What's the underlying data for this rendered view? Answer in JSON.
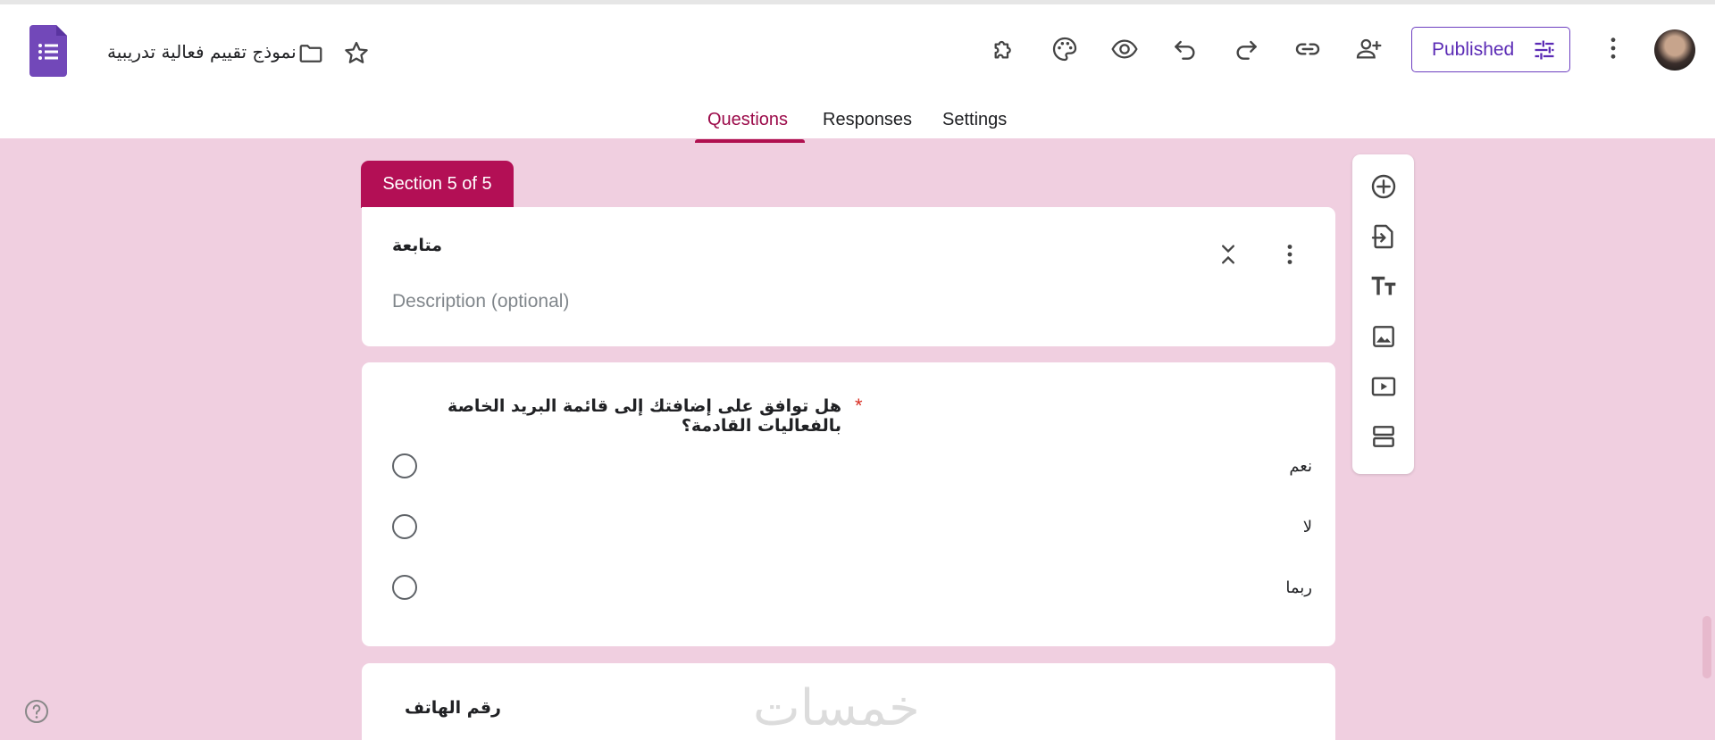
{
  "header": {
    "form_title": "نموذج تقييم فعالية تدريبية",
    "published_label": "Published"
  },
  "tabs": [
    {
      "label": "Questions",
      "active": true
    },
    {
      "label": "Responses",
      "active": false
    },
    {
      "label": "Settings",
      "active": false
    }
  ],
  "section": {
    "tag": "Section 5 of 5",
    "title": "متابعة",
    "description_placeholder": "Description (optional)"
  },
  "question": {
    "text": "هل توافق على إضافتك إلى قائمة البريد الخاصة بالفعاليات القادمة؟",
    "required_mark": "*",
    "options": [
      "نعم",
      "لا",
      "ربما"
    ]
  },
  "next_question": {
    "title": "رقم الهاتف",
    "watermark": "خمسات"
  },
  "icons": {
    "toolbar": [
      "addons-icon",
      "palette-icon",
      "preview-eye-icon",
      "undo-icon",
      "redo-icon",
      "link-icon",
      "add-collaborator-icon"
    ],
    "side_toolbar": [
      "add-question-icon",
      "import-questions-icon",
      "add-title-icon",
      "add-image-icon",
      "add-video-icon",
      "add-section-icon"
    ]
  },
  "colors": {
    "accent": "#b30f55",
    "background": "#f0cfe0",
    "published": "#5b2bb5",
    "logo": "#7248b9"
  }
}
